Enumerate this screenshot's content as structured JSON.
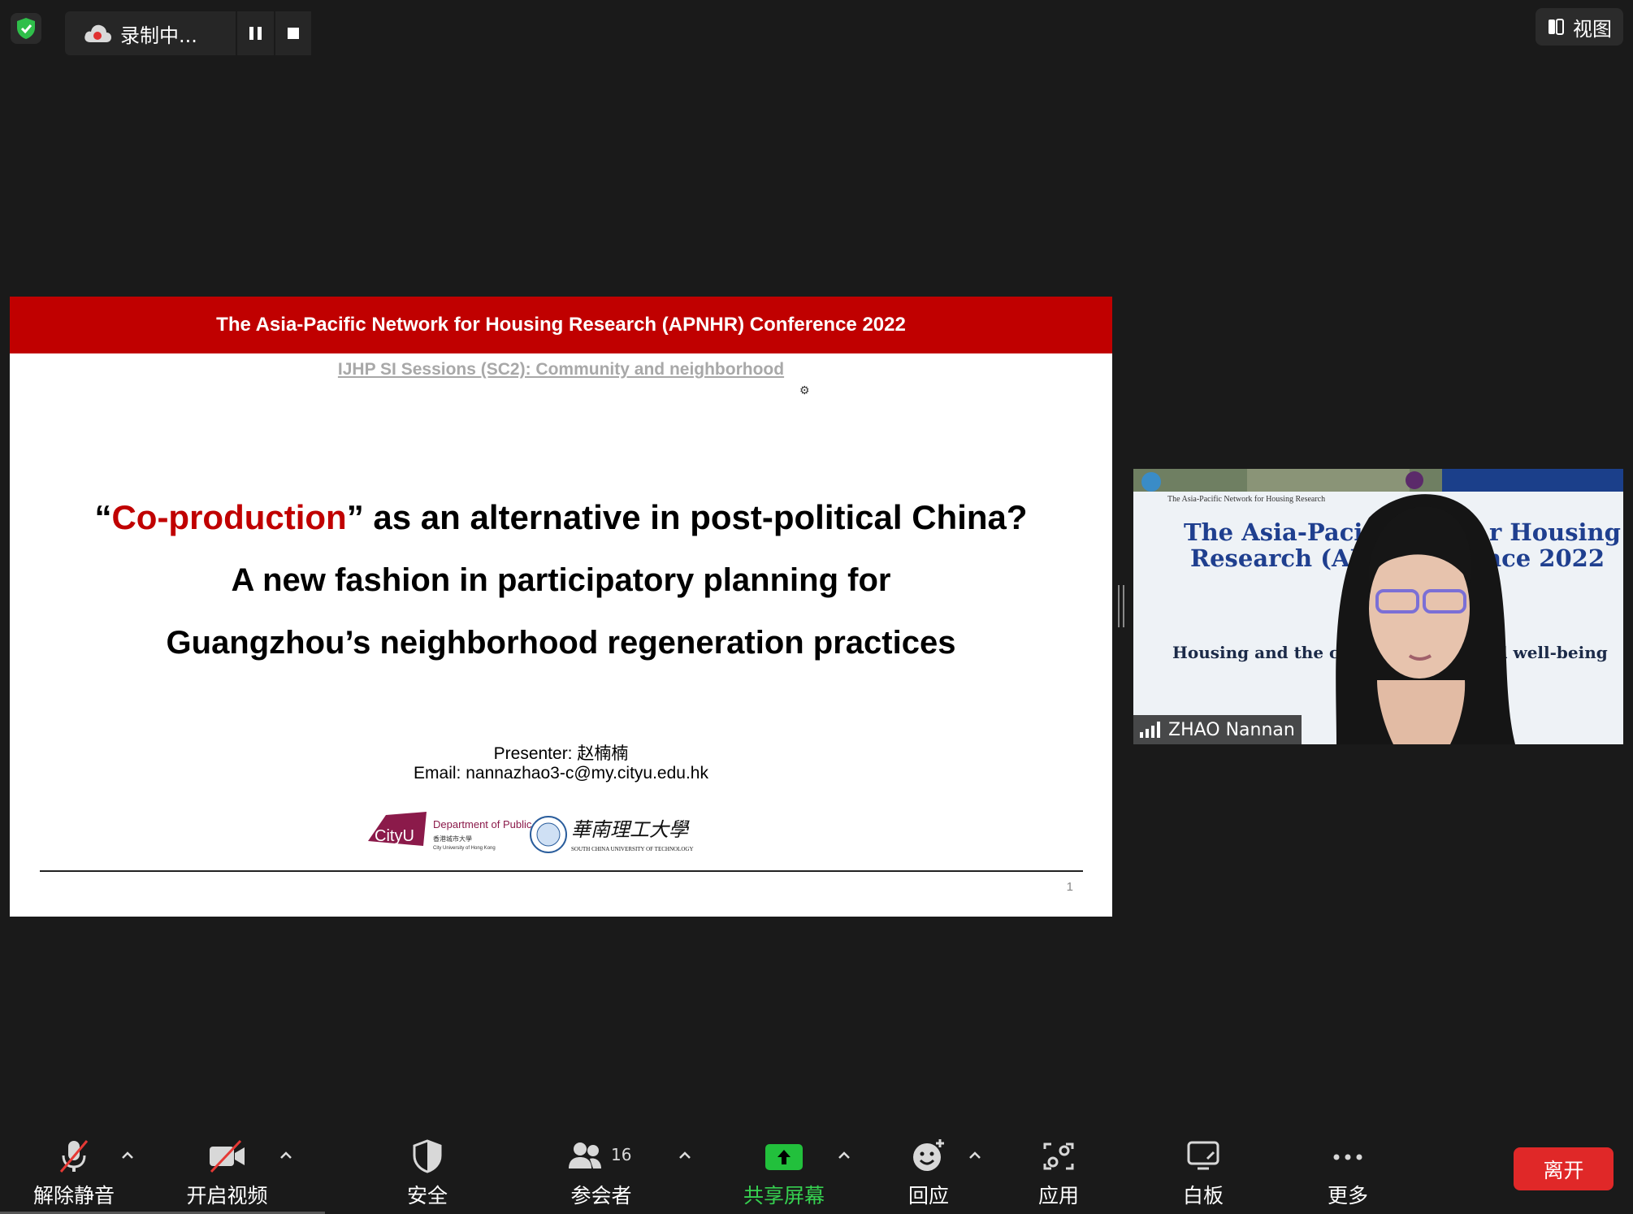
{
  "top_bar": {
    "recording_label": "录制中...",
    "view_label": "视图"
  },
  "slide": {
    "header": "The Asia-Pacific Network for Housing Research (APNHR) Conference 2022",
    "subtitle": "IJHP SI Sessions (SC2): Community and neighborhood",
    "title_open_quote": "“",
    "title_highlight": "Co-production",
    "title_rest": "” as an alternative in post-political China?",
    "title_line2": "A new fashion in participatory planning for",
    "title_line3": "Guangzhou’s neighborhood regeneration practices",
    "presenter": "Presenter: 赵楠楠",
    "email": "Email: nannazhao3-c@my.cityu.edu.hk",
    "logo1_brand": "CityU",
    "logo1_dept": "Department of Public Policy",
    "logo1_sub": "香港城市大學",
    "logo1_sub2": "City University of Hong Kong",
    "logo2_cn": "華南理工大學",
    "logo2_en": "SOUTH CHINA UNIVERSITY OF TECHNOLOGY",
    "page_number": "1"
  },
  "participant": {
    "name": "ZHAO Nannan",
    "bg_small": "The Asia-Pacific Network for Housing Research",
    "bg_title_left1": "The Asia-Pacifi",
    "bg_title_left2": "Research (AP",
    "bg_title_right1": "r Housing",
    "bg_title_right2": "nce 2022",
    "bg_line_left": "Housing and the city",
    "bg_line_right": "nd well-being"
  },
  "toolbar": {
    "unmute": "解除静音",
    "start_video": "开启视频",
    "security": "安全",
    "participants": "参会者",
    "participants_count": "16",
    "share_screen": "共享屏幕",
    "reactions": "回应",
    "apps": "应用",
    "whiteboard": "白板",
    "more": "更多",
    "leave": "离开"
  },
  "colors": {
    "background": "#1a1a1a",
    "slide_red": "#c00000",
    "share_green": "#36d050",
    "leave_red": "#e02828"
  }
}
